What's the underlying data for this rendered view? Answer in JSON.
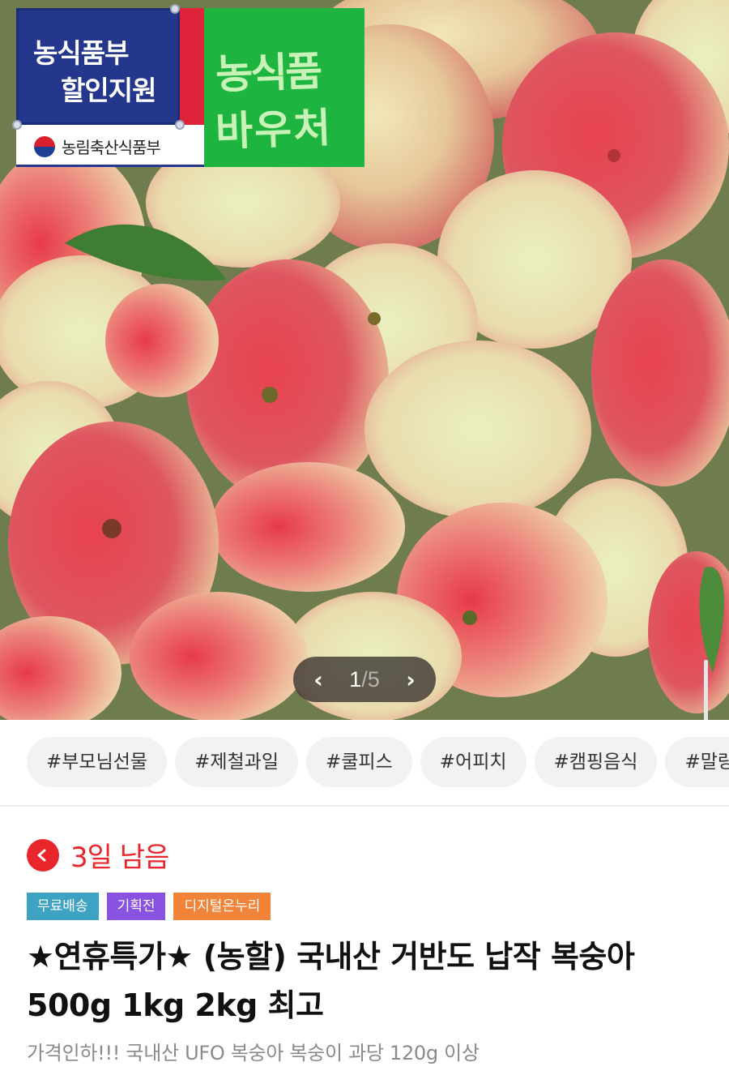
{
  "hero": {
    "badge": {
      "line1": "농식품부",
      "line2": "할인지원",
      "ministry": "농림축산식품부",
      "colors": {
        "navy": "#24378c",
        "red": "#e0223a"
      }
    },
    "voucher": {
      "line1": "농식품",
      "line2": "바우처",
      "color": "#1db53f"
    },
    "pager": {
      "current": "1",
      "separator": "/",
      "total": "5",
      "prev_icon": "chevron-left-icon",
      "next_icon": "chevron-right-icon"
    }
  },
  "tags": [
    "#부모님선물",
    "#제철과일",
    "#쿨피스",
    "#어피치",
    "#캠핑음식",
    "#말랑"
  ],
  "product": {
    "timer_text": "3일 남음",
    "timer_icon": "clock-icon",
    "badges": [
      {
        "label": "무료배송",
        "color": "#3ea3c2"
      },
      {
        "label": "기획전",
        "color": "#8a52e0"
      },
      {
        "label": "디지털온누리",
        "color": "#f2843a"
      }
    ],
    "title": "★연휴특가★ (농할) 국내산 거반도 납작 복숭아 500g 1kg 2kg 최고",
    "subtitle": "가격인하!!! 국내산 UFO 복숭아 복숭이 과당 120g 이상"
  },
  "colors": {
    "accent_red": "#e8262c",
    "tag_bg": "#f2f2f2"
  }
}
